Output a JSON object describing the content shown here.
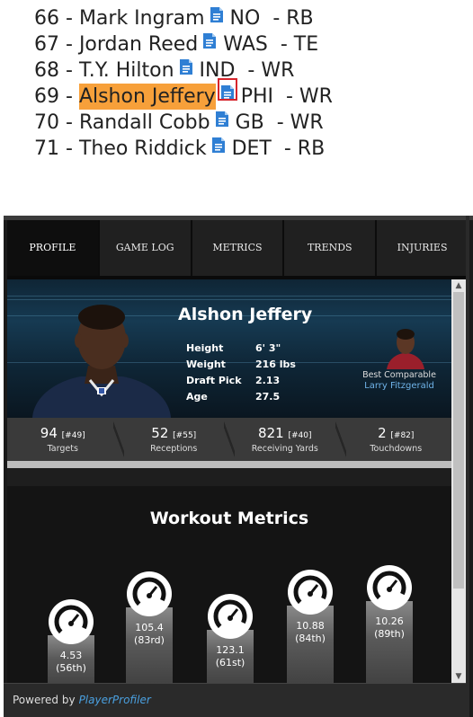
{
  "rankings": [
    {
      "rank": "66",
      "name": "Mark Ingram",
      "team": "NO",
      "pos": "RB"
    },
    {
      "rank": "67",
      "name": "Jordan Reed",
      "team": "WAS",
      "pos": "TE"
    },
    {
      "rank": "68",
      "name": "T.Y. Hilton",
      "team": "IND",
      "pos": "WR"
    },
    {
      "rank": "69",
      "name": "Alshon Jeffery",
      "team": "PHI",
      "pos": "WR",
      "highlighted": true
    },
    {
      "rank": "70",
      "name": "Randall Cobb",
      "team": "GB",
      "pos": "WR"
    },
    {
      "rank": "71",
      "name": "Theo Riddick",
      "team": "DET",
      "pos": "RB"
    }
  ],
  "tabs": [
    "PROFILE",
    "GAME LOG",
    "METRICS",
    "TRENDS",
    "INJURIES"
  ],
  "active_tab": "PROFILE",
  "player": {
    "name": "Alshon Jeffery",
    "bio": [
      {
        "label": "Height",
        "value": "6' 3\""
      },
      {
        "label": "Weight",
        "value": "216 lbs"
      },
      {
        "label": "Draft Pick",
        "value": "2.13"
      },
      {
        "label": "Age",
        "value": "27.5"
      }
    ],
    "best_comparable_label": "Best Comparable",
    "best_comparable_name": "Larry Fitzgerald"
  },
  "stats": [
    {
      "value": "94",
      "rank": "[#49]",
      "label": "Targets"
    },
    {
      "value": "52",
      "rank": "[#55]",
      "label": "Receptions"
    },
    {
      "value": "821",
      "rank": "[#40]",
      "label": "Receiving Yards"
    },
    {
      "value": "2",
      "rank": "[#82]",
      "label": "Touchdowns"
    }
  ],
  "workout": {
    "title": "Workout Metrics",
    "metrics": [
      {
        "value": "4.53",
        "percentile": "(56th)",
        "level": 56
      },
      {
        "value": "105.4",
        "percentile": "(83rd)",
        "level": 83
      },
      {
        "value": "123.1",
        "percentile": "(61st)",
        "level": 61
      },
      {
        "value": "10.88",
        "percentile": "(84th)",
        "level": 84
      },
      {
        "value": "10.26",
        "percentile": "(89th)",
        "level": 89
      }
    ]
  },
  "footer": {
    "powered_by": "Powered by",
    "brand": "PlayerProfiler"
  },
  "colors": {
    "highlight": "#f7a03a",
    "doc_icon": "#2f7fd4",
    "link": "#6fb3e8",
    "callout": "#d6252c"
  },
  "icons": {
    "doc": "document-icon",
    "gauge": "speedometer-icon"
  }
}
